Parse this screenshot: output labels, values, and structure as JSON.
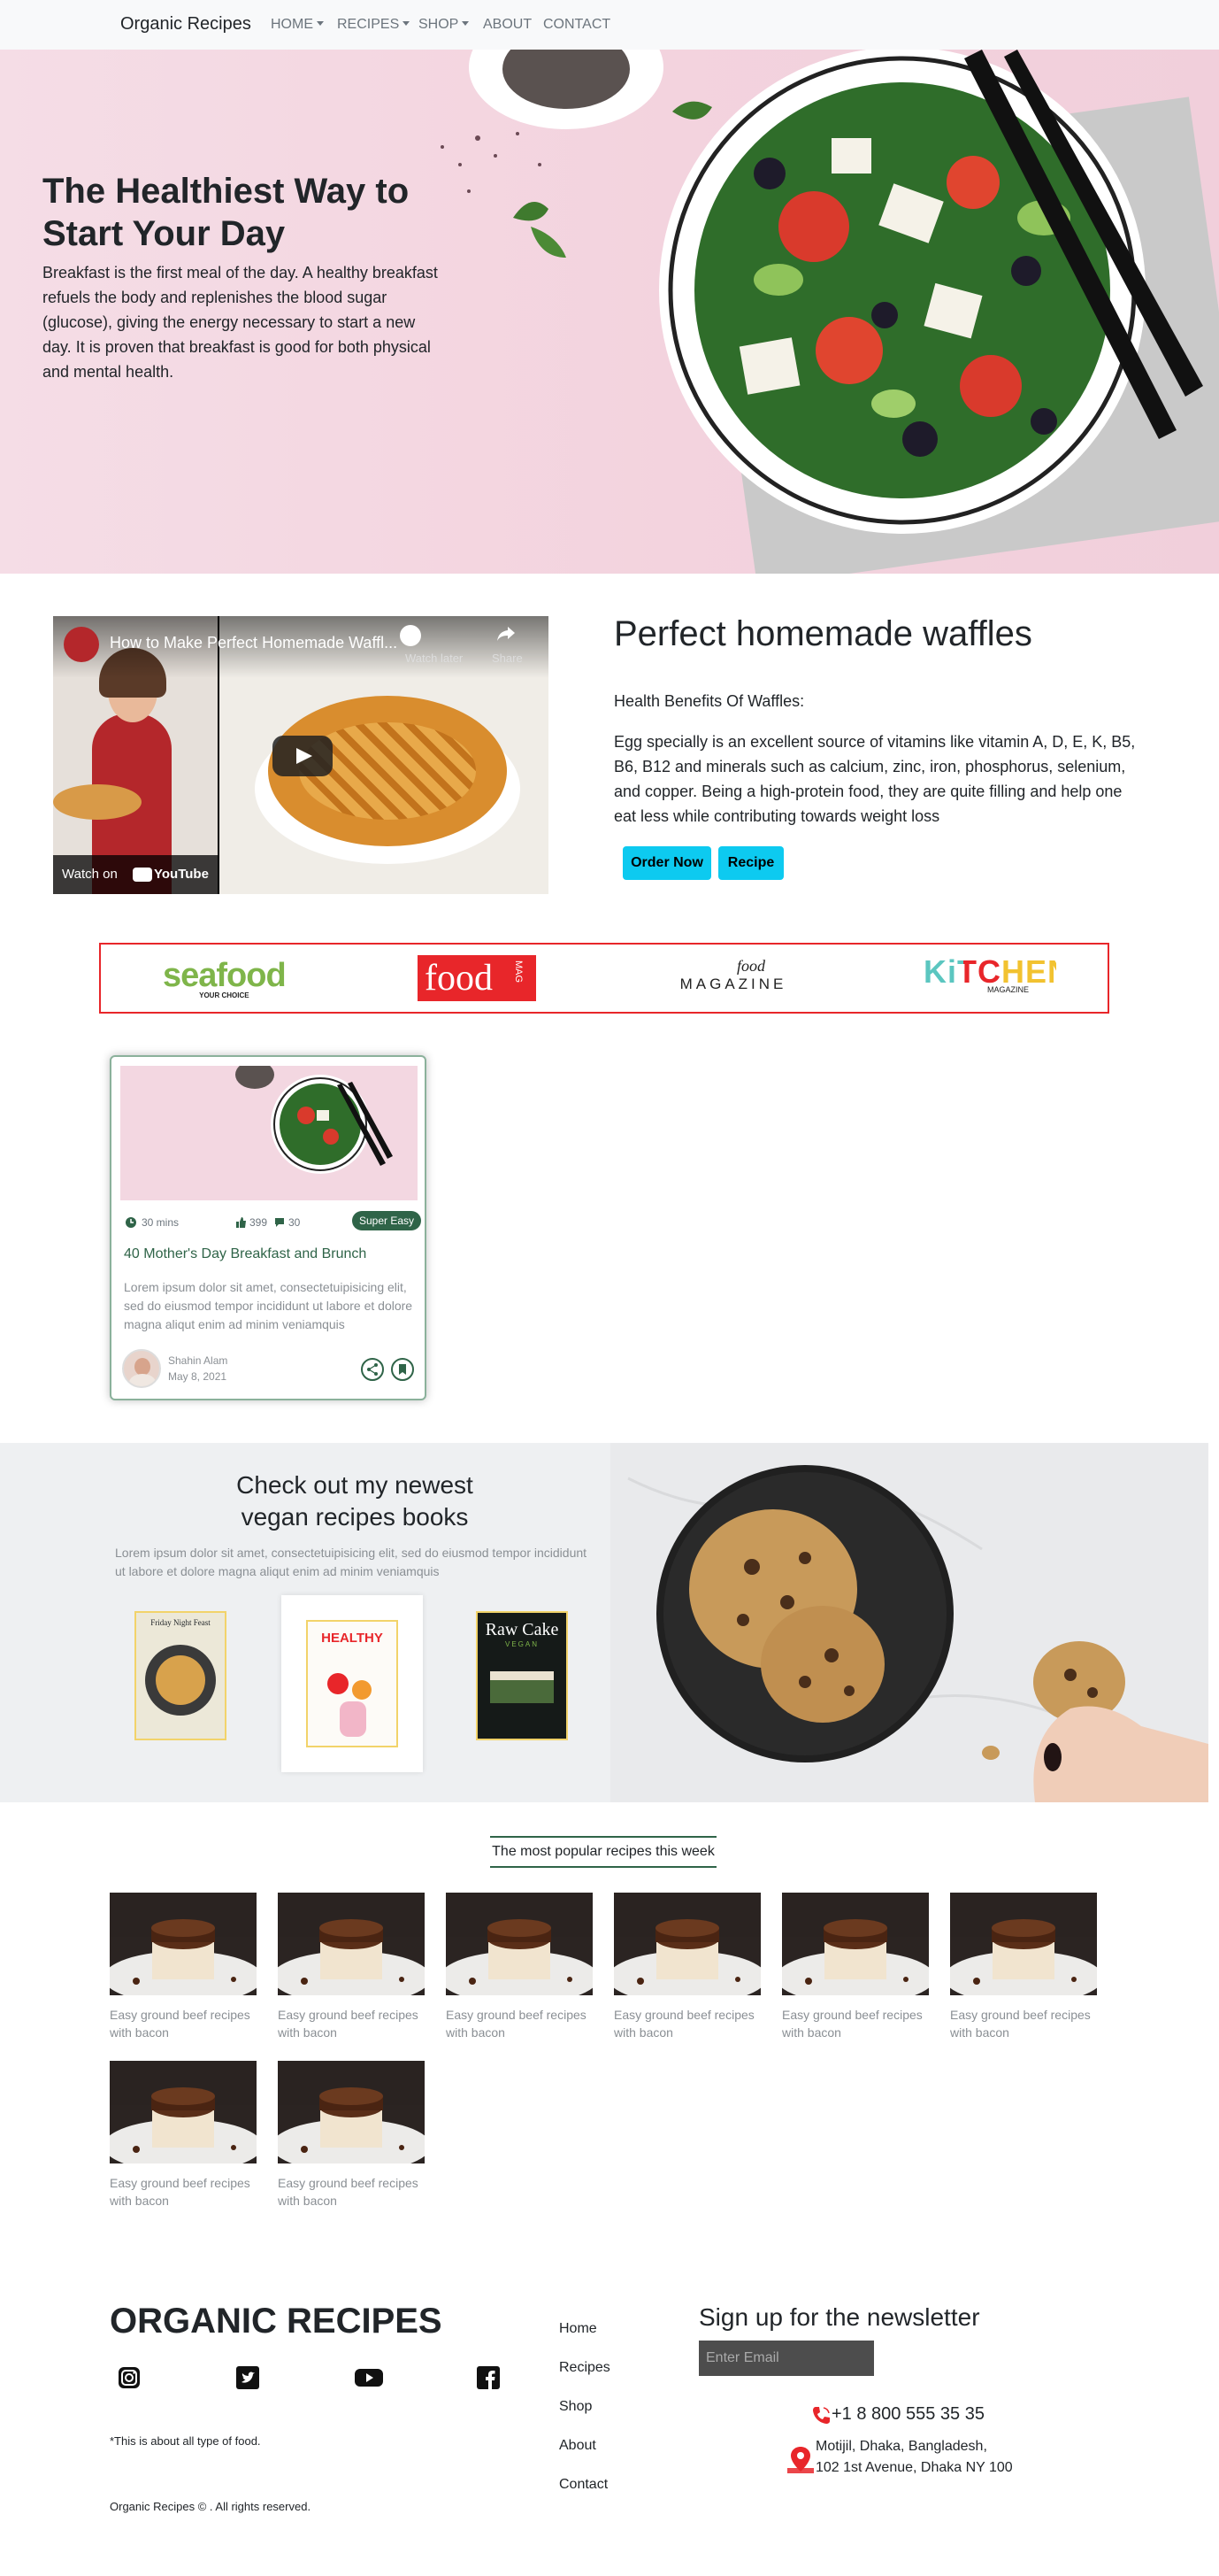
{
  "nav": {
    "brand": "Organic Recipes",
    "items": [
      "HOME",
      "RECIPES",
      "SHOP",
      "ABOUT",
      "CONTACT"
    ]
  },
  "hero": {
    "title": "The Healthiest Way to Start Your Day",
    "text": "Breakfast is the first meal of the day. A healthy breakfast refuels the body and replenishes the blood sugar (glucose), giving the energy necessary to start a new day. It is proven that breakfast is good for both physical and mental health."
  },
  "video": {
    "title": "How to Make Perfect Homemade Waffl...",
    "watch_later": "Watch later",
    "share": "Share",
    "watch_on": "Watch on",
    "youtube": "YouTube"
  },
  "waffles": {
    "title": "Perfect homemade waffles",
    "subtitle": "Health Benefits Of Waffles:",
    "text": "Egg specially is an excellent source of vitamins like vitamin A, D, E, K, B5, B6, B12 and minerals such as calcium, zinc, iron, phosphorus, selenium, and copper. Being a high-protein food, they are quite filling and help one eat less while contributing towards weight loss",
    "order_label": "Order Now",
    "recipe_label": "Recipe"
  },
  "brands": {
    "seafood": "seafood",
    "seafood_tag": "YOUR CHOICE",
    "foodmag": "food",
    "foodmag_tag": "MAG",
    "food_script": "food",
    "magazine": "MAGAZINE",
    "kitchen": "KiTCHEN",
    "kitchen_tag": "MAGAZINE"
  },
  "card": {
    "time": "30 mins",
    "likes": "399",
    "comments": "30",
    "badge": "Super Easy",
    "title": "40 Mother's Day Breakfast and Brunch",
    "text": "Lorem ipsum dolor sit amet, consectetuipisicing elit, sed do eiusmod tempor incididunt ut labore et dolore magna aliqut enim ad minim veniamquis",
    "author": "Shahin Alam",
    "date": "May 8, 2021"
  },
  "vegan": {
    "title": "Check out my newest vegan recipes books",
    "text": "Lorem ipsum dolor sit amet, consectetuipisicing elit, sed do eiusmod tempor incididunt ut labore et dolore magna aliqut enim ad minim veniamquis",
    "book1": "Friday Night Feast",
    "book2": "HEALTHY",
    "book3": "Raw Cake",
    "book3_sub": "VEGAN"
  },
  "popular": {
    "title": "The most popular recipes this week",
    "items": [
      "Easy ground beef recipes with bacon",
      "Easy ground beef recipes with bacon",
      "Easy ground beef recipes with bacon",
      "Easy ground beef recipes with bacon",
      "Easy ground beef recipes with bacon",
      "Easy ground beef recipes with bacon",
      "Easy ground beef recipes with bacon",
      "Easy ground beef recipes with bacon"
    ]
  },
  "footer": {
    "brand": "ORGANIC RECIPES",
    "about": "*This is about all type of food.",
    "copyright": "Organic Recipes © . All rights reserved.",
    "links": [
      "Home",
      "Recipes",
      "Shop",
      "About",
      "Contact"
    ],
    "newsletter_title": "Sign up for the newsletter",
    "email_placeholder": "Enter Email",
    "phone": "+1 8 800 555 35 35",
    "address_line1": "Motijil, Dhaka, Bangladesh,",
    "address_line2": "102 1st Avenue, Dhaka NY 100"
  },
  "colors": {
    "accent_green": "#2f6448",
    "button_cyan": "#0dcaf0",
    "brand_border_red": "#e8262a",
    "footer_icon_red": "#e8262a"
  }
}
